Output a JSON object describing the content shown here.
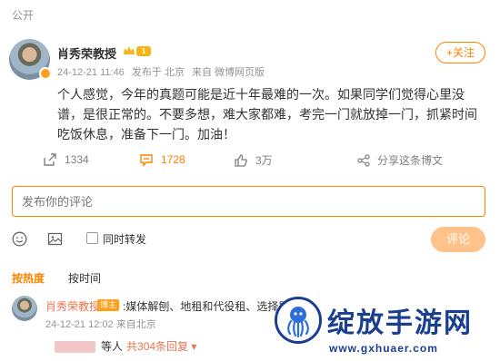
{
  "visibility_label": "公开",
  "author": {
    "name": "肖秀荣教授",
    "level_badge": "1"
  },
  "post_meta": {
    "time": "24-12-21 11:46",
    "published_at": "发布于 北京",
    "source": "来自 微博网页版"
  },
  "follow_label": "+关注",
  "post_text": "个人感觉，今年的真题可能是近十年最难的一次。如果同学们觉得心里没谱，是很正常的。不要多想，难大家都难，考完一门就放掉一门，抓紧时间吃饭休息，准备下一门。加油！",
  "actions": {
    "repost_count": "1334",
    "comment_count": "1728",
    "like_count": "3万",
    "share_label": "分享这条博文"
  },
  "comment_box": {
    "placeholder": "发布你的评论",
    "repost_checkbox_label": "同时转发",
    "submit_label": "评论"
  },
  "sort_tabs": {
    "hot": "按热度",
    "time": "按时间"
  },
  "top_comment": {
    "name": "肖秀荣教授",
    "author_tag": "博主",
    "text": ":媒体解刨、地租和代役租、选择题……",
    "time": "24-12-21 12:02",
    "location": "来自北京",
    "reply_suffix": "等人",
    "reply_count": "共304条回复"
  },
  "watermark": {
    "title": "绽放手游网",
    "url": "www.gxhuaer.com"
  },
  "colors": {
    "accent": "#ff8200",
    "name_link": "#eb7350",
    "muted": "#939393",
    "watermark_blue": "#1a3f8f"
  }
}
